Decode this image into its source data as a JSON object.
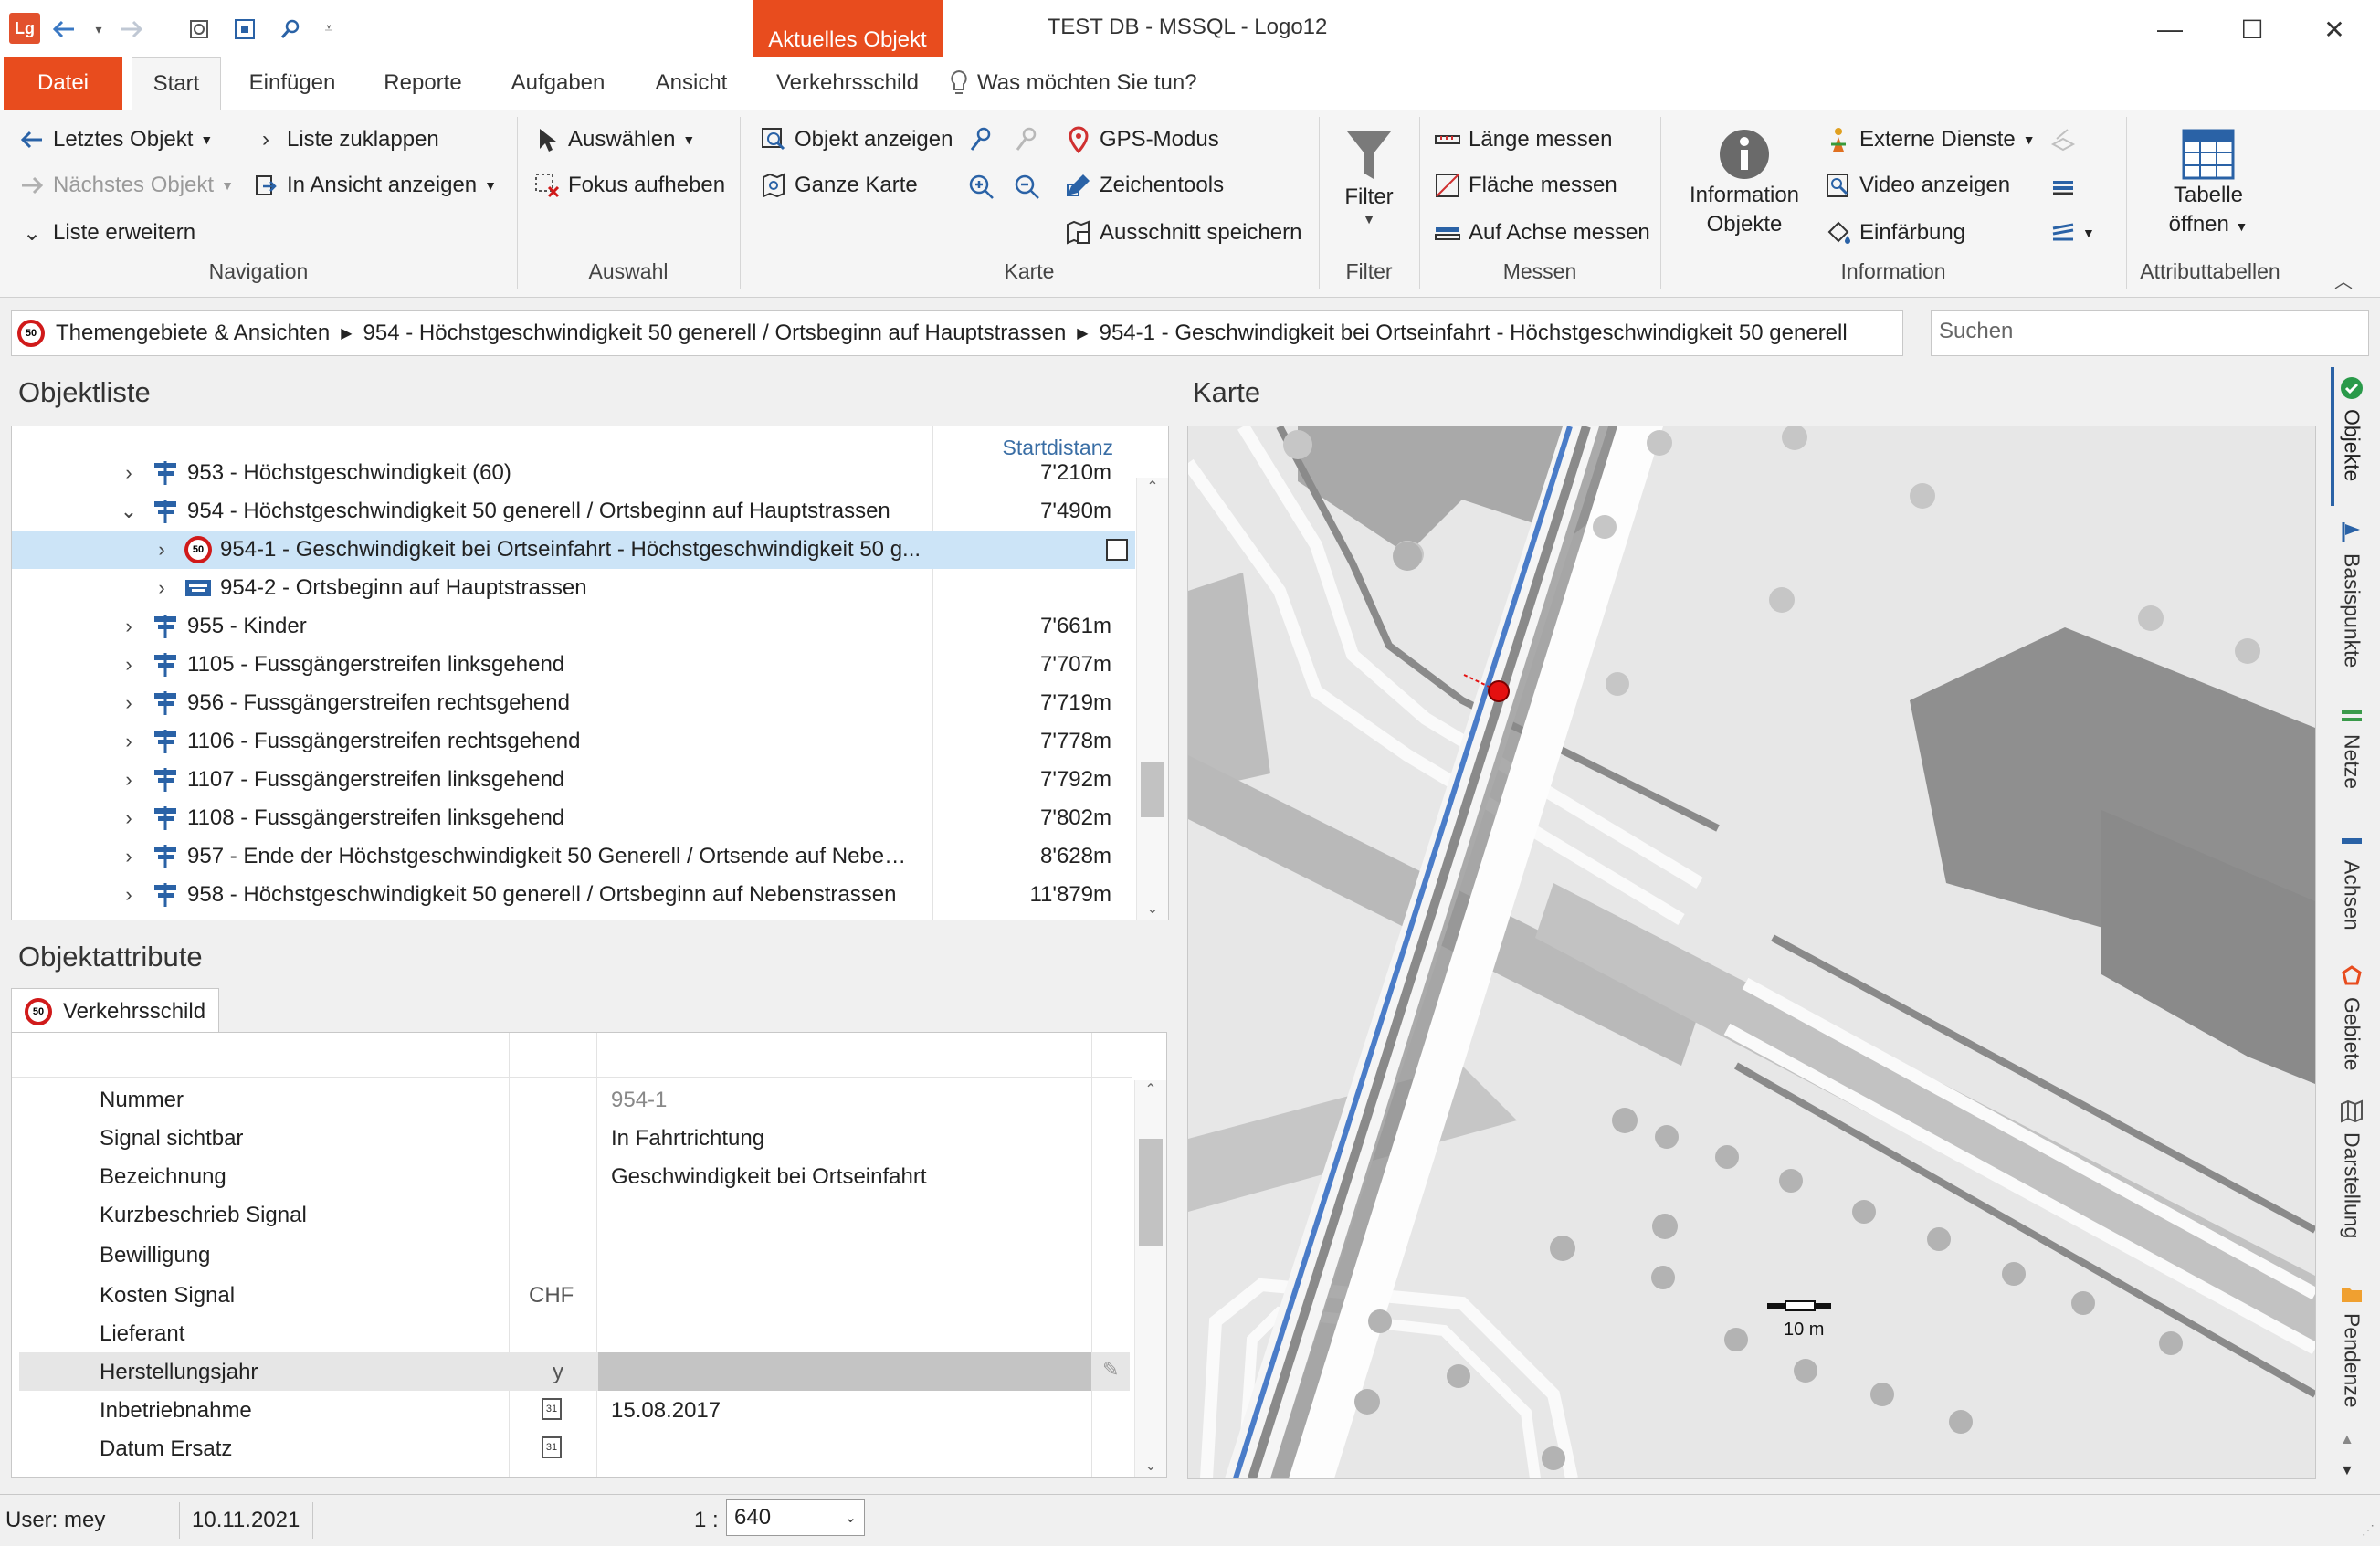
{
  "titlebar": {
    "app_logo": "Lg",
    "context_tab": "Aktuelles Objekt",
    "window_title": "TEST DB - MSSQL - Logo12",
    "minimize_symbol": "—",
    "maximize_symbol": "☐",
    "close_symbol": "✕"
  },
  "ribbon_tabs": {
    "datei": "Datei",
    "start": "Start",
    "einfuegen": "Einfügen",
    "reporte": "Reporte",
    "aufgaben": "Aufgaben",
    "ansicht": "Ansicht",
    "verkehrsschild": "Verkehrsschild",
    "tell_me": "Was möchten Sie tun?"
  },
  "ribbon": {
    "navigation": {
      "label": "Navigation",
      "letztes_objekt": "Letztes Objekt",
      "naechstes_objekt": "Nächstes Objekt",
      "liste_erweitern": "Liste erweitern",
      "liste_zuklappen": "Liste zuklappen",
      "in_ansicht_anzeigen": "In Ansicht anzeigen"
    },
    "auswahl": {
      "label": "Auswahl",
      "auswaehlen": "Auswählen",
      "fokus_aufheben": "Fokus aufheben"
    },
    "karte": {
      "label": "Karte",
      "objekt_anzeigen": "Objekt anzeigen",
      "ganze_karte": "Ganze Karte",
      "gps_modus": "GPS-Modus",
      "zeichentools": "Zeichentools",
      "ausschnitt_speichern": "Ausschnitt speichern"
    },
    "filter": {
      "label": "Filter",
      "button": "Filter"
    },
    "messen": {
      "label": "Messen",
      "laenge": "Länge messen",
      "flaeche": "Fläche messen",
      "achse": "Auf Achse messen"
    },
    "information": {
      "label": "Information",
      "info_objekte_1": "Information",
      "info_objekte_2": "Objekte",
      "externe_dienste": "Externe Dienste",
      "video_anzeigen": "Video anzeigen",
      "einfaerbung": "Einfärbung"
    },
    "attributtabellen": {
      "label": "Attributtabellen",
      "tabelle_1": "Tabelle",
      "tabelle_2": "öffnen"
    }
  },
  "breadcrumb": {
    "items": [
      "Themengebiete & Ansichten",
      "954 - Höchstgeschwindigkeit 50 generell / Ortsbeginn auf Hauptstrassen",
      "954-1 - Geschwindigkeit bei Ortseinfahrt - Höchstgeschwindigkeit 50 generell"
    ],
    "search_placeholder": "Suchen"
  },
  "objektliste": {
    "title": "Objektliste",
    "column_header": "Startdistanz",
    "rows": [
      {
        "label": "953 - Höchstgeschwindigkeit (60)",
        "dist": "7'210m"
      },
      {
        "label": "954 - Höchstgeschwindigkeit 50 generell / Ortsbeginn auf Hauptstrassen",
        "dist": "7'490m"
      },
      {
        "label": "954-1 - Geschwindigkeit bei Ortseinfahrt - Höchstgeschwindigkeit 50 g...",
        "dist": ""
      },
      {
        "label": "954-2 - Ortsbeginn auf Hauptstrassen",
        "dist": ""
      },
      {
        "label": "955 - Kinder",
        "dist": "7'661m"
      },
      {
        "label": "1105 - Fussgängerstreifen linksgehend",
        "dist": "7'707m"
      },
      {
        "label": "956 - Fussgängerstreifen rechtsgehend",
        "dist": "7'719m"
      },
      {
        "label": "1106 - Fussgängerstreifen rechtsgehend",
        "dist": "7'778m"
      },
      {
        "label": "1107 - Fussgängerstreifen linksgehend",
        "dist": "7'792m"
      },
      {
        "label": "1108 - Fussgängerstreifen linksgehend",
        "dist": "7'802m"
      },
      {
        "label": "957 - Ende der Höchstgeschwindigkeit 50 Generell / Ortsende auf Nebens...",
        "dist": "8'628m"
      },
      {
        "label": "958 - Höchstgeschwindigkeit 50 generell / Ortsbeginn auf Nebenstrassen",
        "dist": "11'879m"
      }
    ]
  },
  "objektattribute": {
    "title": "Objektattribute",
    "tab": "Verkehrsschild",
    "rows": [
      {
        "label": "Nummer",
        "unit": "",
        "value": "954-1"
      },
      {
        "label": "Signal sichtbar",
        "unit": "",
        "value": "In Fahrtrichtung"
      },
      {
        "label": "Bezeichnung",
        "unit": "",
        "value": "Geschwindigkeit bei Ortseinfahrt"
      },
      {
        "label": "Kurzbeschrieb Signal",
        "unit": "",
        "value": ""
      },
      {
        "label": "Bewilligung",
        "unit": "",
        "value": ""
      },
      {
        "label": "Kosten Signal",
        "unit": "CHF",
        "value": ""
      },
      {
        "label": "Lieferant",
        "unit": "",
        "value": ""
      },
      {
        "label": "Herstellungsjahr",
        "unit": "y",
        "value": ""
      },
      {
        "label": "Inbetriebnahme",
        "unit": "",
        "value": "15.08.2017"
      },
      {
        "label": "Datum Ersatz",
        "unit": "",
        "value": ""
      }
    ]
  },
  "karte": {
    "title": "Karte",
    "scale_label": "10 m"
  },
  "side_tabs": [
    "Objekte",
    "Basispunkte",
    "Netze",
    "Achsen",
    "Gebiete",
    "Darstellung",
    "Pendenze"
  ],
  "statusbar": {
    "user": "User: mey",
    "date": "10.11.2021",
    "scale_prefix": "1 :",
    "scale_value": "640"
  },
  "colors": {
    "accent": "#e84c1e",
    "selection": "#cce4f7",
    "link_blue": "#2a62a6",
    "map_line": "#4a7cc8",
    "marker": "#e41010"
  }
}
